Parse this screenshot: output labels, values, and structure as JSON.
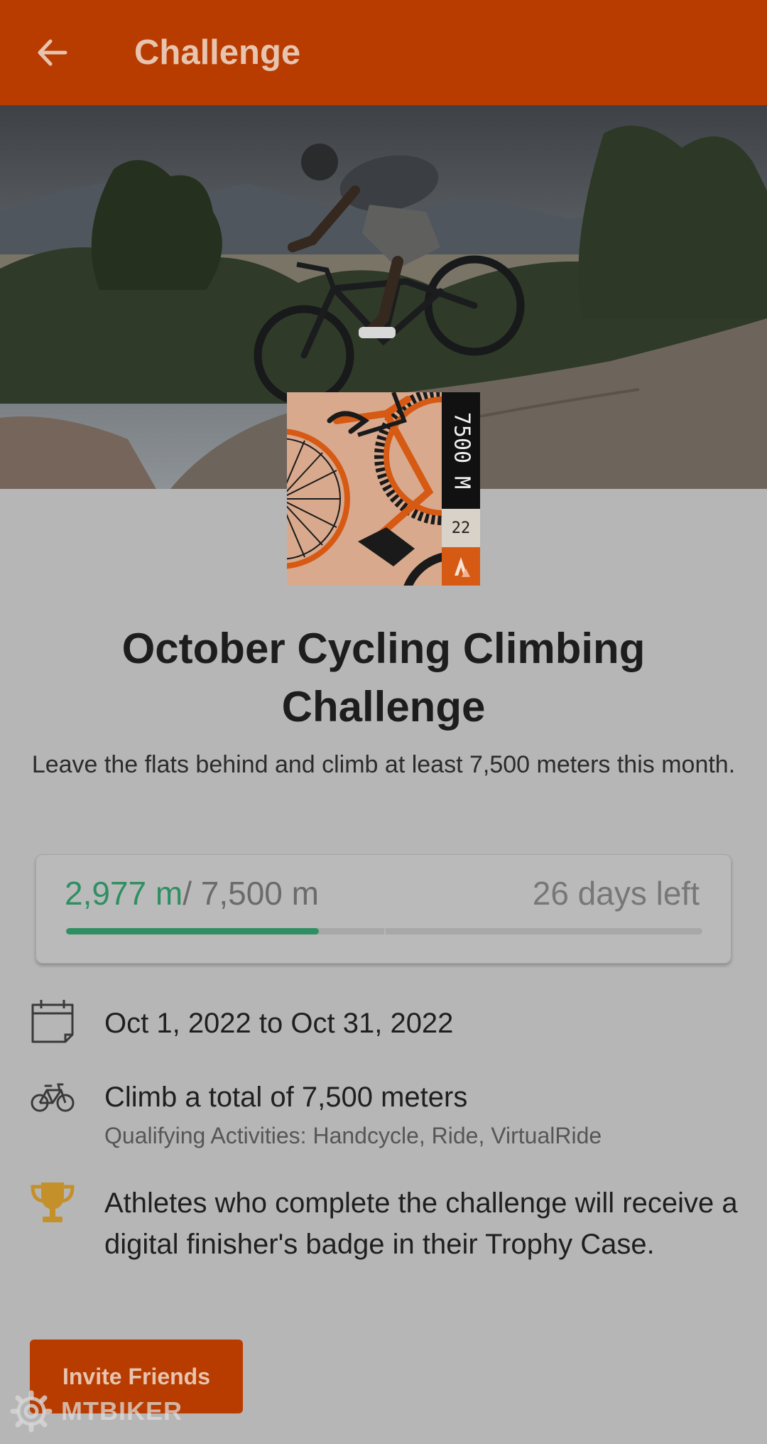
{
  "appbar": {
    "title": "Challenge",
    "back_icon": "arrow-left-icon",
    "background": "#b83c00"
  },
  "badge": {
    "distance_label": "7500 M",
    "year_label": "22",
    "logo_icon": "strava-chevron-icon",
    "accent": "#d65a14"
  },
  "challenge": {
    "title": "October Cycling Climbing Challenge",
    "description": "Leave the flats behind and climb at least 7,500 meters this month."
  },
  "progress": {
    "current": "2,977 m",
    "separator": "/",
    "goal": " 7,500 m",
    "days_left": "26 days left",
    "fraction": 0.397,
    "color": "#2f8f63"
  },
  "details": {
    "dates": "Oct 1, 2022 to Oct 31, 2022",
    "date_icon": "calendar-icon",
    "goal": "Climb a total of 7,500 meters",
    "goal_icon": "bicycle-icon",
    "qualifying": "Qualifying Activities: Handcycle, Ride, VirtualRide",
    "reward": "Athletes who complete the challenge will receive a digital finisher's badge in their Trophy Case.",
    "reward_icon": "trophy-icon",
    "trophy_color": "#c4902a"
  },
  "actions": {
    "invite_label": "Invite Friends"
  },
  "watermark": {
    "text": "MTBIKER",
    "icon": "gear-logo-icon"
  }
}
